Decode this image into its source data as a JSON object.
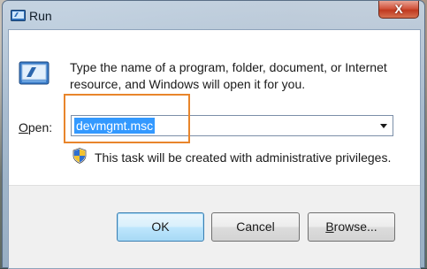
{
  "window": {
    "title": "Run",
    "close_label": "X"
  },
  "dialog": {
    "description": "Type the name of a program, folder, document, or Internet resource, and Windows will open it for you.",
    "open_label_prefix": "O",
    "open_label_rest": "pen:",
    "input_value": "devmgmt.msc",
    "admin_note": "This task will be created with administrative privileges."
  },
  "buttons": {
    "ok": "OK",
    "cancel": "Cancel",
    "browse_prefix": "B",
    "browse_rest": "rowse..."
  },
  "icons": {
    "title": "run-icon",
    "main": "run-icon",
    "shield": "uac-shield-icon",
    "dropdown": "chevron-down-icon"
  },
  "colors": {
    "selection": "#3399ff",
    "highlight_box": "#e8852b",
    "close_button": "#c0391f",
    "ok_border": "#3c7fb1"
  }
}
